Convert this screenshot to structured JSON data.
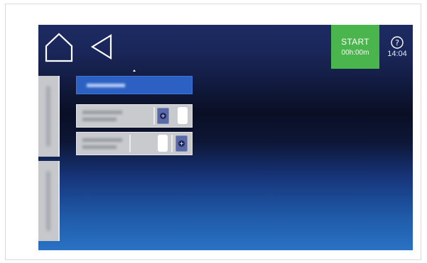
{
  "topbar": {
    "start_label": "START",
    "start_time": "00h:00m",
    "clock": "14:04",
    "icons": [
      "home-icon",
      "back-arrow-icon",
      "help-icon"
    ]
  },
  "colors": {
    "start_green": "#49b54c",
    "field_blue": "#2c60c3",
    "panel_gray": "#c8cacd",
    "plus_button": "#5a6aa6"
  }
}
